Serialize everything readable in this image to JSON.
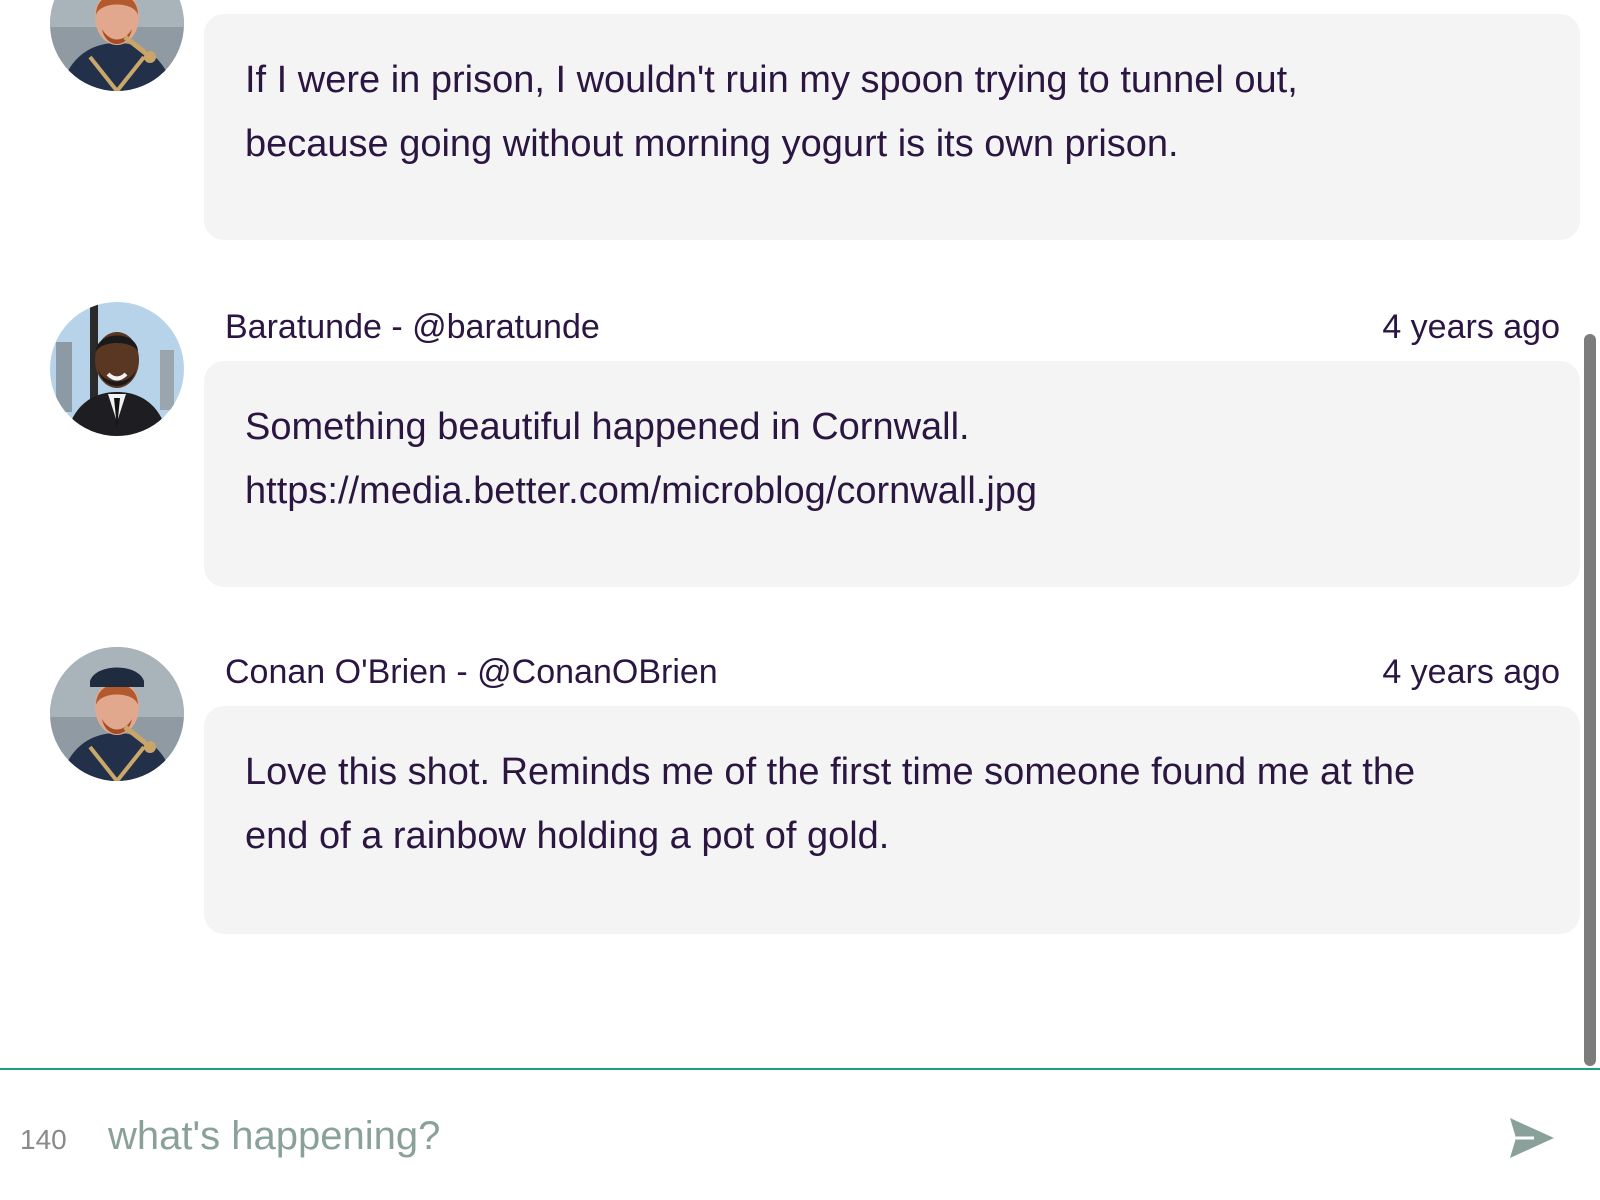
{
  "feed": {
    "posts": [
      {
        "author": "",
        "time": "",
        "body_line1": "If I were in prison, I wouldn't ruin my spoon trying to tunnel out,",
        "body_line2": "because going without morning yogurt is its own prison.",
        "avatar_icon": "conan-avatar"
      },
      {
        "author": "Baratunde - @baratunde",
        "time": "4 years ago",
        "body_line1": "Something beautiful happened in Cornwall.",
        "body_line2": "https://media.better.com/microblog/cornwall.jpg",
        "avatar_icon": "baratunde-avatar"
      },
      {
        "author": "Conan O'Brien - @ConanOBrien",
        "time": "4 years ago",
        "body_line1": "Love this shot. Reminds me of the first time someone found me at the",
        "body_line2": "end of a rainbow holding a pot of gold.",
        "avatar_icon": "conan-avatar"
      }
    ]
  },
  "composer": {
    "counter": "140",
    "placeholder": "what's happening?",
    "value": "",
    "send_icon": "send-icon"
  },
  "colors": {
    "text": "#2a1641",
    "bubble": "#f4f4f4",
    "accent": "#1aa37a",
    "placeholder": "#8aa19b"
  }
}
